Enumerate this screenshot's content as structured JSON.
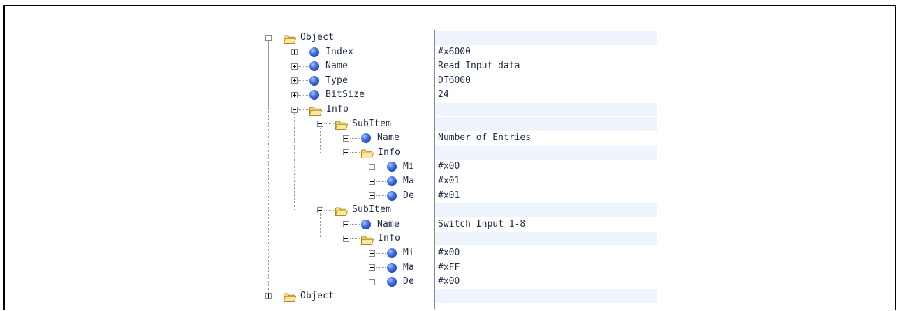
{
  "tree": {
    "rows": [
      {
        "label": "Object",
        "value": "",
        "icon": "folder",
        "expander": "minus",
        "indent": 0
      },
      {
        "label": "Index",
        "value": "#x6000",
        "icon": "ball",
        "expander": "plus",
        "indent": 1
      },
      {
        "label": "Name",
        "value": "Read Input data",
        "icon": "ball",
        "expander": "plus",
        "indent": 1
      },
      {
        "label": "Type",
        "value": "DT6000",
        "icon": "ball",
        "expander": "plus",
        "indent": 1
      },
      {
        "label": "BitSize",
        "value": "24",
        "icon": "ball",
        "expander": "plus",
        "indent": 1
      },
      {
        "label": "Info",
        "value": "",
        "icon": "folder",
        "expander": "minus",
        "indent": 1
      },
      {
        "label": "SubItem",
        "value": "",
        "icon": "folder",
        "expander": "minus",
        "indent": 2
      },
      {
        "label": "Name",
        "value": "Number of Entries",
        "icon": "ball",
        "expander": "plus",
        "indent": 3
      },
      {
        "label": "Info",
        "value": "",
        "icon": "folder",
        "expander": "minus",
        "indent": 3
      },
      {
        "label": "Mi",
        "value": "#x00",
        "icon": "ball",
        "expander": "plus",
        "indent": 4
      },
      {
        "label": "Ma",
        "value": "#x01",
        "icon": "ball",
        "expander": "plus",
        "indent": 4
      },
      {
        "label": "De",
        "value": "#x01",
        "icon": "ball",
        "expander": "plus",
        "indent": 4
      },
      {
        "label": "SubItem",
        "value": "",
        "icon": "folder",
        "expander": "minus",
        "indent": 2
      },
      {
        "label": "Name",
        "value": "Switch Input 1-8",
        "icon": "ball",
        "expander": "plus",
        "indent": 3
      },
      {
        "label": "Info",
        "value": "",
        "icon": "folder",
        "expander": "minus",
        "indent": 3
      },
      {
        "label": "Mi",
        "value": "#x00",
        "icon": "ball",
        "expander": "plus",
        "indent": 4
      },
      {
        "label": "Ma",
        "value": "#xFF",
        "icon": "ball",
        "expander": "plus",
        "indent": 4
      },
      {
        "label": "De",
        "value": "#x00",
        "icon": "ball",
        "expander": "plus",
        "indent": 4
      },
      {
        "label": "Object",
        "value": "",
        "icon": "folder",
        "expander": "plus",
        "indent": 0
      }
    ]
  },
  "colors": {
    "text": "#1d2b4a",
    "value_bg": "#eef4fb",
    "folder": "#f2c94c",
    "ball": "#2f5bd3"
  }
}
